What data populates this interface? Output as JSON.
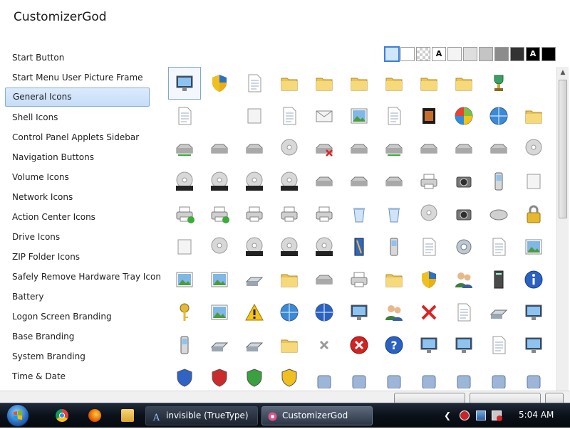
{
  "window": {
    "title": "CustomizerGod"
  },
  "sidebar": {
    "items": [
      {
        "label": "Start Button"
      },
      {
        "label": "Start Menu User Picture Frame"
      },
      {
        "label": "General Icons",
        "selected": true
      },
      {
        "label": "Shell Icons"
      },
      {
        "label": "Control Panel Applets Sidebar"
      },
      {
        "label": "Navigation Buttons"
      },
      {
        "label": "Volume Icons"
      },
      {
        "label": "Network Icons"
      },
      {
        "label": "Action Center Icons"
      },
      {
        "label": "Drive Icons"
      },
      {
        "label": "ZIP Folder Icons"
      },
      {
        "label": "Safely Remove Hardware Tray Icon"
      },
      {
        "label": "Battery"
      },
      {
        "label": "Logon Screen Branding"
      },
      {
        "label": "Base Branding"
      },
      {
        "label": "System Branding"
      },
      {
        "label": "Time & Date"
      }
    ]
  },
  "background_swatches": [
    {
      "color": "#cfe6fb",
      "label": "",
      "selected": true
    },
    {
      "color": "#ffffff",
      "label": ""
    },
    {
      "color": "#e8e8e8",
      "label": "",
      "checker": true
    },
    {
      "color": "#ffffff",
      "label": "A"
    },
    {
      "color": "#f4f4f4",
      "label": ""
    },
    {
      "color": "#dedede",
      "label": ""
    },
    {
      "color": "#c4c4c4",
      "label": ""
    },
    {
      "color": "#8c8c8c",
      "label": ""
    },
    {
      "color": "#333333",
      "label": ""
    },
    {
      "color": "#000000",
      "label": "A",
      "text_color": "#ffffff"
    },
    {
      "color": "#000000",
      "label": ""
    }
  ],
  "icon_grid": {
    "rows": [
      [
        "window-stack-icon",
        "shield-uac-icon",
        "blank-page-icon",
        "folder-open-icon",
        "folder-icon",
        "folder-narrow-icon",
        "folder-search-icon",
        "folder-blue-icon",
        "folder-slim-blue-icon",
        "trophy-icon"
      ],
      [
        "document-preview-icon",
        "",
        "library-search-icon",
        "text-document-icon",
        "mail-envelope-icon",
        "picture-frame-icon",
        "music-sheet-icon",
        "film-strip-icon",
        "media-center-icon",
        "globe-network-icon",
        "printer-folder-icon"
      ],
      [
        "network-drive-icon",
        "floppy-drive-icon",
        "removable-drive-icon",
        "cd-drive-icon",
        "drive-error-icon",
        "hard-drive-icon",
        "network-drive-connected-icon",
        "memory-chip-icon",
        "drive-slim-icon",
        "windows-drive-icon",
        "dvd-drive-icon"
      ],
      [
        "dvd-r-icon",
        "dvd-ram-icon",
        "dvd-rom-icon",
        "dvd-rw-icon",
        "blue-disk-icon",
        "tape-drive-icon",
        "drive-blue-icon",
        "network-printer-icon",
        "camcorder-icon",
        "mobile-phone-icon",
        "floppy-check-icon"
      ],
      [
        "printer-check-icon",
        "network-printer-check-icon",
        "printer-icon",
        "printer-floppy-icon",
        "printer-network-icon",
        "recycle-bin-empty-icon",
        "recycle-bin-full-icon",
        "dvd-icon",
        "camera-icon",
        "mouse-icon",
        "lock-icon"
      ],
      [
        "media-player-icon",
        "cd-icon",
        "cd-r-icon",
        "cd-rom-icon",
        "cd-rw-icon",
        "pen-tablet-icon",
        "device-phone-icon",
        "gear-document-icon",
        "system-gear-icon",
        "settings-page-icon",
        "photo-card-icon"
      ],
      [
        "landscape-picture-icon",
        "scenery-picture-icon",
        "network-share-icon",
        "network-folder-share-icon",
        "drive-help-icon",
        "fax-icon",
        "font-folder-icon",
        "shield-warning-icon",
        "users-icon",
        "server-icon",
        "info-icon"
      ],
      [
        "key-icon",
        "photo-gallery-icon",
        "warning-triangle-icon",
        "music-disc-icon",
        "sync-arrows-icon",
        "control-panel-icon",
        "user-group-icon",
        "red-x-icon",
        "document-lines-icon",
        "scanner-icon",
        "projector-screen-icon"
      ],
      [
        "pda-icon",
        "network-adapter-icon",
        "flatbed-scanner-icon",
        "blue-folder-book-icon",
        "grey-x-icon",
        "error-circle-icon",
        "help-circle-icon",
        "display-icon",
        "monitor-moon-icon",
        "blank-list-icon",
        "presentation-icon"
      ],
      [
        "help-shield-icon",
        "red-shield-icon",
        "green-shield-icon",
        "yellow-shield-icon",
        "partial-icon",
        "partial-icon",
        "partial-icon",
        "partial-icon",
        "partial-icon",
        "partial-icon",
        "partial-icon"
      ]
    ],
    "selected_row": 0,
    "selected_col": 0
  },
  "taskbar": {
    "buttons": [
      {
        "label": "invisible (TrueType)",
        "icon": "font-app-icon"
      },
      {
        "label": "CustomizerGod",
        "icon": "customizergod-app-icon",
        "active": true
      }
    ],
    "clock": "5:04 AM"
  }
}
